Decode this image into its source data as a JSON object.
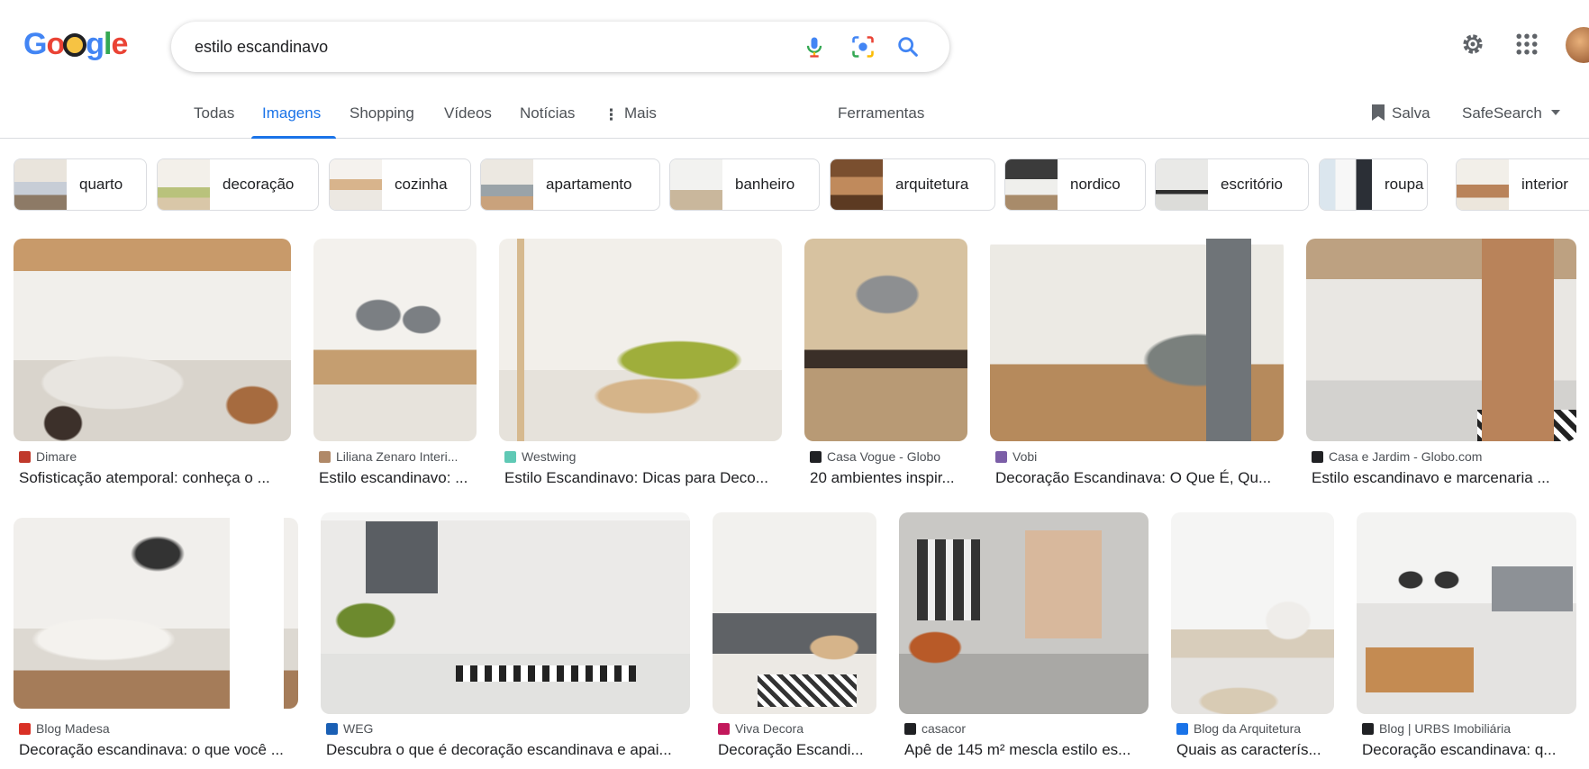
{
  "search": {
    "query": "estilo escandinavo"
  },
  "logo": {
    "letters": [
      "G",
      "o",
      "o",
      "g",
      "l",
      "e"
    ]
  },
  "tabs": [
    {
      "label": "Todas"
    },
    {
      "label": "Imagens"
    },
    {
      "label": "Shopping"
    },
    {
      "label": "Vídeos"
    },
    {
      "label": "Notícias"
    },
    {
      "label": "Mais"
    }
  ],
  "tools_label": "Ferramentas",
  "saved_label": "Salva",
  "safesearch_label": "SafeSearch",
  "chips": [
    {
      "label": "quarto"
    },
    {
      "label": "decoração"
    },
    {
      "label": "cozinha"
    },
    {
      "label": "apartamento"
    },
    {
      "label": "banheiro"
    },
    {
      "label": "arquitetura"
    },
    {
      "label": "nordico"
    },
    {
      "label": "escritório"
    },
    {
      "label": "roupa"
    },
    {
      "label": "interior"
    }
  ],
  "results": [
    {
      "source": "Dimare",
      "title": "Sofisticação atemporal: conheça o ...",
      "favicon_color": "#c0392b"
    },
    {
      "source": "Liliana Zenaro Interi...",
      "title": "Estilo escandinavo: ...",
      "favicon_color": "#b08968"
    },
    {
      "source": "Westwing",
      "title": "Estilo Escandinavo: Dicas para Deco...",
      "favicon_color": "#5fc9b5"
    },
    {
      "source": "Casa Vogue - Globo",
      "title": "20 ambientes inspir...",
      "favicon_color": "#202124"
    },
    {
      "source": "Vobi",
      "title": "Decoração Escandinava: O Que É, Qu...",
      "favicon_color": "#7b5ea7"
    },
    {
      "source": "Casa e Jardim - Globo.com",
      "title": "Estilo escandinavo e marcenaria ...",
      "favicon_color": "#202124"
    },
    {
      "source": "Blog Madesa",
      "title": "Decoração escandinava: o que você ...",
      "favicon_color": "#d93025"
    },
    {
      "source": "WEG",
      "title": "Descubra o que é decoração escandinava e apai...",
      "favicon_color": "#1a5fb4"
    },
    {
      "source": "Viva Decora",
      "title": "Decoração Escandi...",
      "favicon_color": "#c2185b"
    },
    {
      "source": "casacor",
      "title": "Apê de 145 m² mescla estilo es...",
      "favicon_color": "#202124"
    },
    {
      "source": "Blog da Arquitetura",
      "title": "Quais as caracterís...",
      "favicon_color": "#1a73e8"
    },
    {
      "source": "Blog | URBS Imobiliária",
      "title": "Decoração escandinava: q...",
      "favicon_color": "#202124"
    }
  ],
  "colors": {
    "accent": "#1a73e8",
    "text": "#202124",
    "muted": "#4d5156",
    "border": "#dadce0"
  },
  "icons": {
    "mic": "microphone-icon",
    "lens": "google-lens-icon",
    "search": "search-icon",
    "settings": "gear-icon",
    "apps": "apps-grid-icon",
    "saved": "bookmark-icon",
    "more": "more-vertical-icon",
    "safesearch": "chevron-down-icon"
  }
}
